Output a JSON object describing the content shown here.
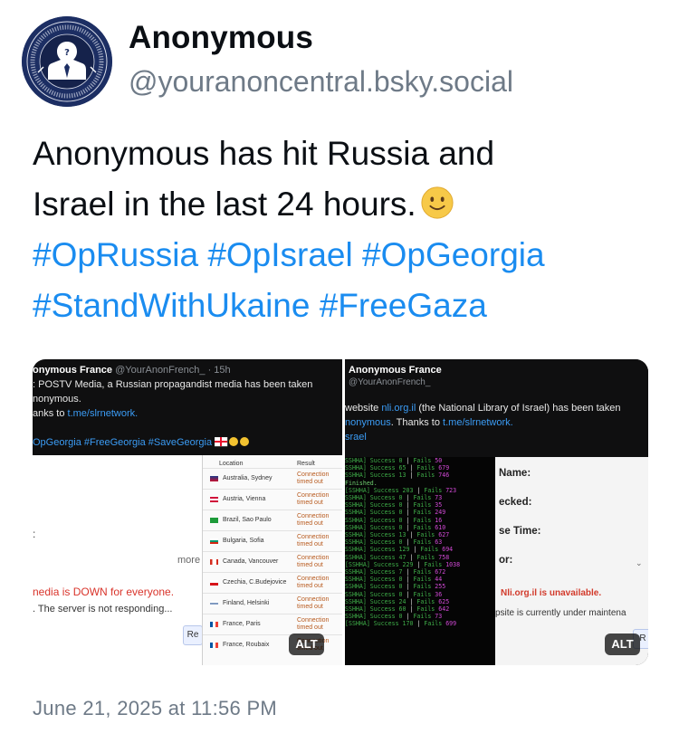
{
  "author": {
    "name": "Anonymous",
    "handle": "@youranoncentral.bsky.social",
    "avatar_icon": "anonymous-emblem-icon"
  },
  "post": {
    "text_lines": [
      "Anonymous has hit Russia and",
      "Israel in the last 24 hours."
    ],
    "emoji": "slightly-smiling-face-icon",
    "hashtags_line1": [
      "#OpRussia",
      "#OpIsrael",
      "#OpGeorgia"
    ],
    "hashtags_line2": [
      "#StandWithUkaine",
      "#FreeGaza"
    ],
    "timestamp": "June 21, 2025 at 11:56 PM"
  },
  "media_left": {
    "tweet": {
      "name": "onymous France",
      "meta": "@YourAnonFrench_ · 15h",
      "line1": ": POSTV Media, a Russian propagandist media has been taken",
      "line2": "nonymous.",
      "line3_prefix": "anks to",
      "line3_link": "t.me/slrnetwork.",
      "tags": "OpGeorgia #FreeGeorgia #SaveGeorgia"
    },
    "check": {
      "location_header": "Location",
      "result_header": "Result",
      "rows": [
        {
          "city": "Australia, Sydney",
          "result": "Connection timed out"
        },
        {
          "city": "Austria, Vienna",
          "result": "Connection timed out"
        },
        {
          "city": "Brazil, Sao Paulo",
          "result": "Connection timed out"
        },
        {
          "city": "Bulgaria, Sofia",
          "result": "Connection timed out"
        },
        {
          "city": "Canada, Vancouver",
          "result": "Connection timed out"
        },
        {
          "city": "Czechia, C.Budejovice",
          "result": "Connection timed out"
        },
        {
          "city": "Finland, Helsinki",
          "result": "Connection timed out"
        },
        {
          "city": "France, Paris",
          "result": "Connection timed out"
        },
        {
          "city": "France, Roubaix",
          "result": "Connection timed out"
        }
      ],
      "more": "more",
      "colon": ":",
      "down_message": "nedia is DOWN for everyone.",
      "responding_message": ". The server is not responding...",
      "button_label": "Re"
    },
    "alt_label": "ALT"
  },
  "media_right": {
    "tweet": {
      "name": "Anonymous France",
      "handle": "@YourAnonFrench_",
      "line1_prefix": "website",
      "line1_link": "nli.org.il",
      "line1_suffix": "(the National Library of Israel) has been taken",
      "line2_link1": "nonymous",
      "line2_mid": ". Thanks to",
      "line2_link2": "t.me/slrnetwork.",
      "line3_link": "srael"
    },
    "terminal": {
      "lines": [
        {
          "label": "SSHHA] Success",
          "success": "0",
          "fails": "50"
        },
        {
          "label": "SSHHA] Success",
          "success": "65",
          "fails": "679"
        },
        {
          "label": "SSHHA] Success",
          "success": "13",
          "fails": "746"
        },
        {
          "special": "Finished."
        },
        {
          "label": "[SSHHA] Success",
          "success": "203",
          "fails": "723",
          "total": true
        },
        {
          "label": "SSHHA] Success",
          "success": "0",
          "fails": "73"
        },
        {
          "label": "SSHHA] Success",
          "success": "0",
          "fails": "35"
        },
        {
          "label": "SSHHA] Success",
          "success": "0",
          "fails": "249"
        },
        {
          "label": "SSHHA] Success",
          "success": "0",
          "fails": "16"
        },
        {
          "label": "SSHHA] Success",
          "success": "0",
          "fails": "610"
        },
        {
          "label": "SSHHA] Success",
          "success": "13",
          "fails": "627"
        },
        {
          "label": "SSHHA] Success",
          "success": "0",
          "fails": "63"
        },
        {
          "label": "SSHHA] Success",
          "success": "129",
          "fails": "694"
        },
        {
          "label": "SSHHA] Success",
          "success": "47",
          "fails": "758"
        },
        {
          "label": "[SSHHA] Success",
          "success": "229",
          "fails": "1038",
          "total": true
        },
        {
          "label": "SSHHA] Success",
          "success": "7",
          "fails": "672"
        },
        {
          "label": "SSHHA] Success",
          "success": "0",
          "fails": "44"
        },
        {
          "label": "SSHHA] Success",
          "success": "0",
          "fails": "255"
        },
        {
          "label": "SSHHA] Success",
          "success": "0",
          "fails": "36"
        },
        {
          "label": "SSHHA] Success",
          "success": "24",
          "fails": "625"
        },
        {
          "label": "SSHHA] Success",
          "success": "60",
          "fails": "642"
        },
        {
          "label": "SSHHA] Success",
          "success": "0",
          "fails": "73"
        },
        {
          "label": "[SSHHA] Success",
          "success": "170",
          "fails": "699",
          "total": true
        }
      ]
    },
    "form": {
      "name_label": "Name:",
      "checked_label": "ecked:",
      "response_label": "se Time:",
      "error_label": "or:",
      "unavailable": "Nli.org.il is unavailable.",
      "maintenance": "psite is currently under maintena",
      "corner_label": "R"
    },
    "alt_label": "ALT"
  },
  "colors": {
    "hashtag": "#1a8cf0",
    "handle": "#6e7a87",
    "terminal_green": "#3fae49",
    "terminal_magenta": "#d44ad8",
    "error_red": "#d23a2b"
  }
}
